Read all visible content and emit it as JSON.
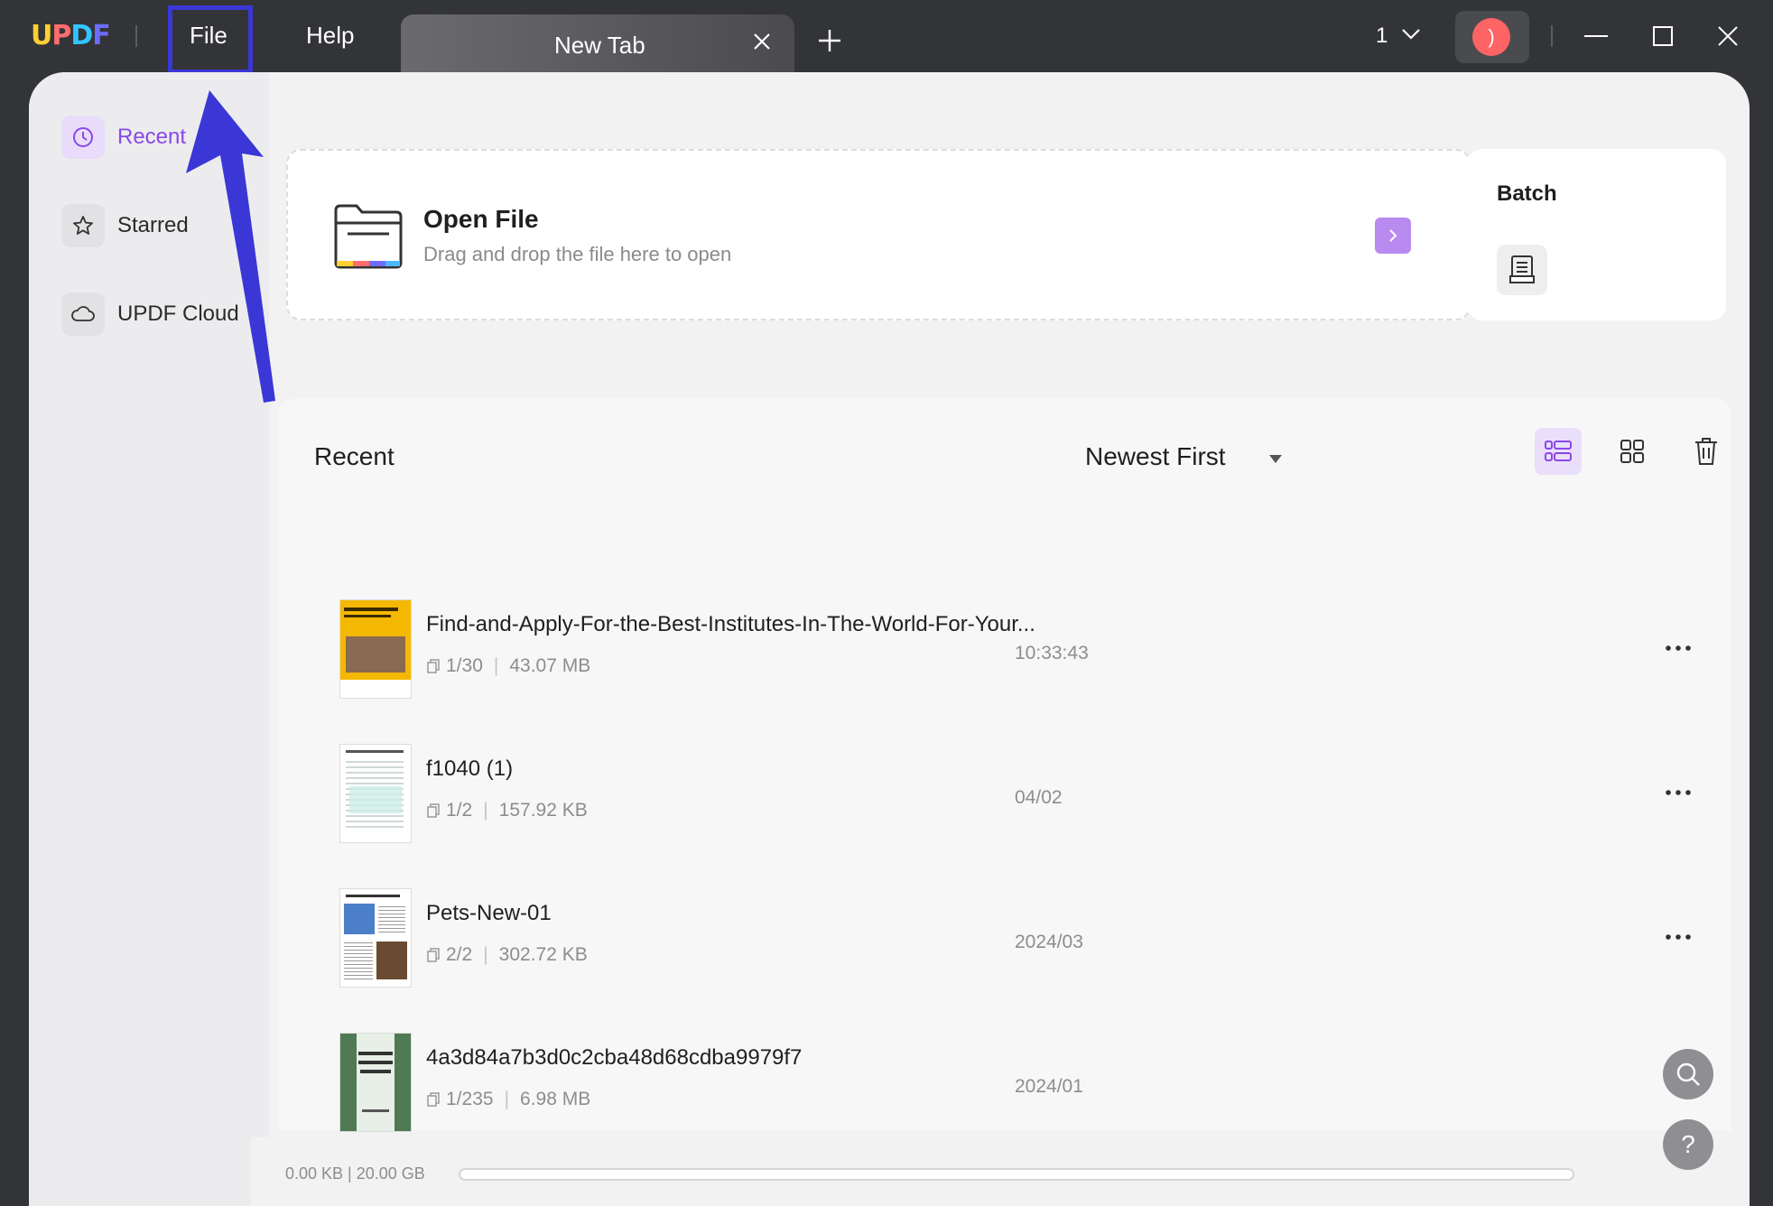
{
  "window": {
    "menu_file": "File",
    "menu_help": "Help",
    "tab_label": "New Tab",
    "tab_count": "1",
    "avatar_initial": ")"
  },
  "sidebar": {
    "items": [
      {
        "label": "Recent",
        "icon": "clock-icon",
        "active": true
      },
      {
        "label": "Starred",
        "icon": "star-icon",
        "active": false
      },
      {
        "label": "UPDF Cloud",
        "icon": "cloud-icon",
        "active": false
      }
    ]
  },
  "open_file": {
    "title": "Open File",
    "subtitle": "Drag and drop the file here to open"
  },
  "batch": {
    "title": "Batch"
  },
  "recent": {
    "header": "Recent",
    "sort_label": "Newest First",
    "files": [
      {
        "name": "Find-and-Apply-For-the-Best-Institutes-In-The-World-For-Your...",
        "pages": "1/30",
        "size": "43.07 MB",
        "date": "10:33:43"
      },
      {
        "name": "f1040 (1)",
        "pages": "1/2",
        "size": "157.92 KB",
        "date": "04/02"
      },
      {
        "name": "Pets-New-01",
        "pages": "2/2",
        "size": "302.72 KB",
        "date": "2024/03"
      },
      {
        "name": "4a3d84a7b3d0c2cba48d68cdba9979f7",
        "pages": "1/235",
        "size": "6.98 MB",
        "date": "2024/01"
      }
    ]
  },
  "storage": {
    "text": "0.00 KB | 20.00 GB",
    "used_fraction": 0.0
  },
  "colors": {
    "accent": "#8a48e6",
    "highlight_box": "#3a37d6"
  }
}
